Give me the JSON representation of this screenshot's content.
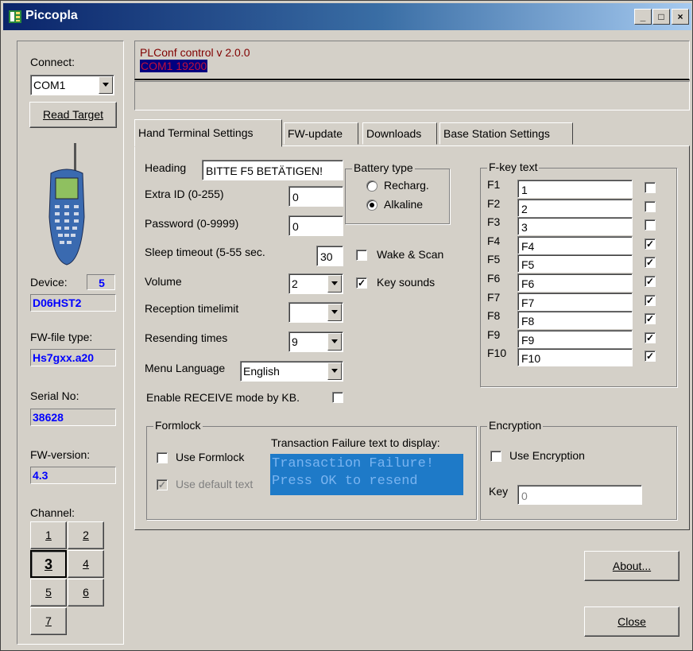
{
  "window": {
    "title": "Piccopla",
    "btn_min": "_",
    "btn_max": "□",
    "btn_close": "×"
  },
  "left": {
    "connect_label": "Connect:",
    "com_value": "COM1",
    "read_target": "Read Target",
    "device_label": "Device:",
    "device_num": "5",
    "device_name": "D06HST2",
    "fwfile_label": "FW-file type:",
    "fwfile_value": "Hs7gxx.a20",
    "serial_label": "Serial No:",
    "serial_value": "38628",
    "fwver_label": "FW-version:",
    "fwver_value": "4.3",
    "channel_label": "Channel:",
    "channels": [
      "1",
      "2",
      "3",
      "4",
      "5",
      "6",
      "7"
    ],
    "selected_channel": "3"
  },
  "status": {
    "line1": "PLConf control v 2.0.0",
    "line2": "COM1 19200"
  },
  "tabs": [
    "Hand Terminal Settings",
    "FW-update",
    "Downloads",
    "Base Station Settings"
  ],
  "hts": {
    "heading_label": "Heading",
    "heading_value": "BITTE F5 BETÄTIGEN!",
    "extraid_label": "Extra ID (0-255)",
    "extraid_value": "0",
    "password_label": "Password (0-9999)",
    "password_value": "0",
    "sleep_label": "Sleep timeout (5-55 sec.",
    "sleep_value": "30",
    "volume_label": "Volume",
    "volume_value": "2",
    "reception_label": "Reception timelimit",
    "reception_value": "",
    "resend_label": "Resending times",
    "resend_value": "9",
    "menulang_label": "Menu Language",
    "menulang_value": "English",
    "enable_receive_label": "Enable RECEIVE mode by KB.",
    "battery": {
      "caption": "Battery type",
      "recharg": "Recharg.",
      "alkaline": "Alkaline"
    },
    "wake_scan": "Wake & Scan",
    "key_sounds": "Key sounds",
    "fkey": {
      "caption": "F-key text",
      "rows": [
        {
          "label": "F1",
          "value": "1",
          "checked": false
        },
        {
          "label": "F2",
          "value": "2",
          "checked": false
        },
        {
          "label": "F3",
          "value": "3",
          "checked": false
        },
        {
          "label": "F4",
          "value": "F4",
          "checked": true
        },
        {
          "label": "F5",
          "value": "F5",
          "checked": true
        },
        {
          "label": "F6",
          "value": "F6",
          "checked": true
        },
        {
          "label": "F7",
          "value": "F7",
          "checked": true
        },
        {
          "label": "F8",
          "value": "F8",
          "checked": true
        },
        {
          "label": "F9",
          "value": "F9",
          "checked": true
        },
        {
          "label": "F10",
          "value": "F10",
          "checked": true
        }
      ]
    },
    "formlock": {
      "caption": "Formlock",
      "use_formlock": "Use Formlock",
      "use_default_text": "Use default text",
      "failure_label": "Transaction Failure text to display:",
      "failure_line1": "Transaction Failure!",
      "failure_line2": "Press OK to resend"
    },
    "encryption": {
      "caption": "Encryption",
      "use_encryption": "Use Encryption",
      "key_label": "Key",
      "key_value": "0"
    }
  },
  "buttons": {
    "about": "About...",
    "close": "Close"
  },
  "colors": {
    "status_text": "#800000",
    "status_highlight": "#000080",
    "formlock_bg": "#1e7ac8",
    "formlock_text": "#7ab4f0",
    "blue_value": "#0000ff"
  }
}
